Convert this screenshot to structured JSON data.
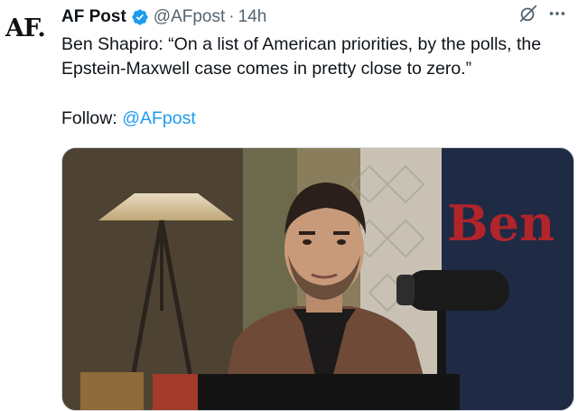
{
  "avatar": {
    "text": "AF."
  },
  "header": {
    "display_name": "AF Post",
    "handle": "@AFpost",
    "separator": "·",
    "time": "14h",
    "icons": [
      "verified-badge-icon",
      "grok-icon",
      "more-icon"
    ],
    "verified_color": "#1d9bf0"
  },
  "tweet": {
    "text": "Ben Shapiro: “On a list of American priorities, by the polls, the Epstein-Maxwell case comes in pretty close to zero.”",
    "follow_label": "Follow:",
    "follow_mention": "@AFpost"
  },
  "media": {
    "backdrop_text": "Ben"
  },
  "colors": {
    "accent": "#1d9bf0",
    "text": "#0f1419",
    "muted": "#536471"
  }
}
